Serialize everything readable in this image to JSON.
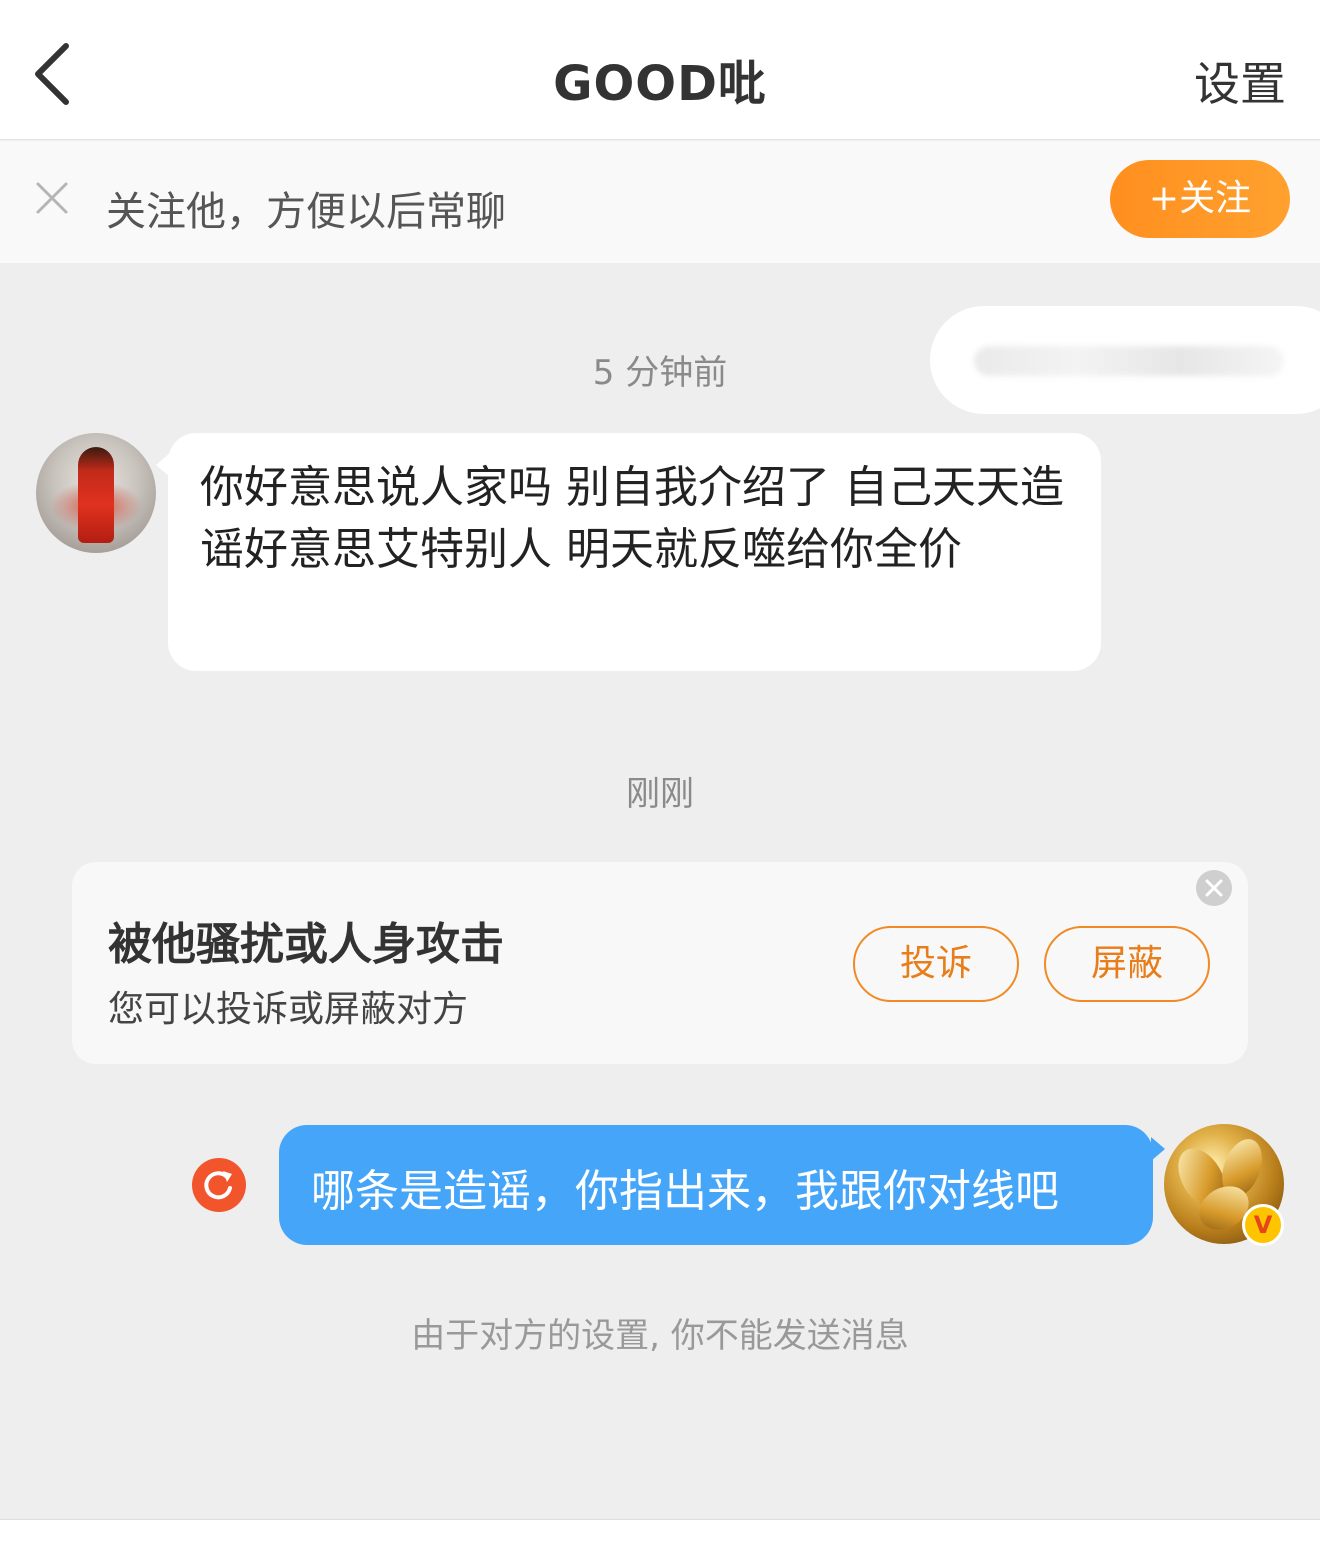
{
  "header": {
    "title": "GOOD吡",
    "settings_label": "设置"
  },
  "follow_banner": {
    "text": "关注他，方便以后常聊",
    "follow_button": "+关注"
  },
  "messages": [
    {
      "timestamp": "5 分钟前",
      "direction": "incoming",
      "text": "你好意思说人家吗 别自我介绍了 自己天天造谣好意思艾特别人 明天就反噬给你全价"
    },
    {
      "timestamp": "刚刚",
      "direction": "outgoing",
      "text": "哪条是造谣，你指出来，我跟你对线吧",
      "status": "failed"
    }
  ],
  "report_card": {
    "title": "被他骚扰或人身攻击",
    "subtitle": "您可以投诉或屏蔽对方",
    "report_button": "投诉",
    "block_button": "屏蔽"
  },
  "verified_badge": "V",
  "notice": "由于对方的设置, 你不能发送消息",
  "colors": {
    "accent_orange": "#ff9520",
    "outgoing_bubble": "#45a5f9",
    "resend_red": "#f2552c",
    "background": "#eeeeee"
  }
}
